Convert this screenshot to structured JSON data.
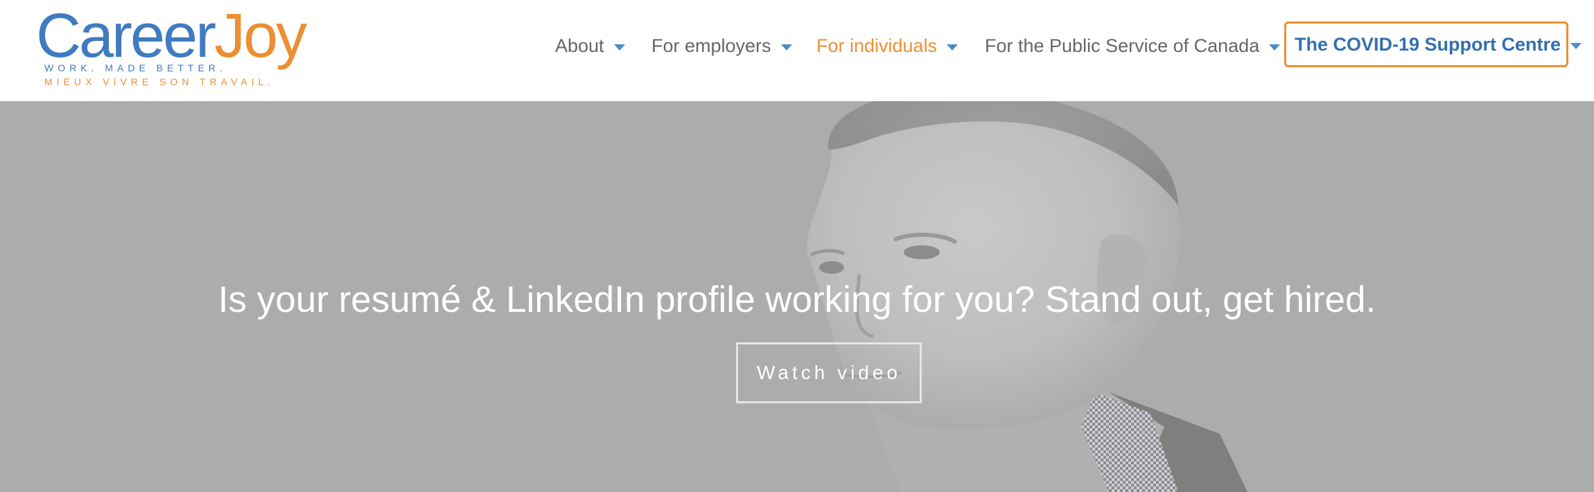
{
  "logo": {
    "career": "Career",
    "joy": "Joy",
    "tagline_en": "WORK. MADE BETTER.",
    "tagline_fr": "MIEUX VIVRE SON TRAVAIL."
  },
  "nav": {
    "items": [
      {
        "label": "About"
      },
      {
        "label": "For employers"
      },
      {
        "label": "For individuals",
        "active": true
      },
      {
        "label": "For the Public Service of Canada"
      }
    ],
    "highlight": {
      "label": "The COVID-19 Support Centre"
    }
  },
  "hero": {
    "headline": "Is your resumé & LinkedIn profile working for you? Stand out, get hired.",
    "button_label": "Watch video",
    "image": "man-portrait-photo"
  },
  "colors": {
    "brand_blue": "#3f7bbf",
    "brand_orange": "#ec8f33",
    "nav_text": "#666666",
    "hero_overlay": "#acacac"
  }
}
